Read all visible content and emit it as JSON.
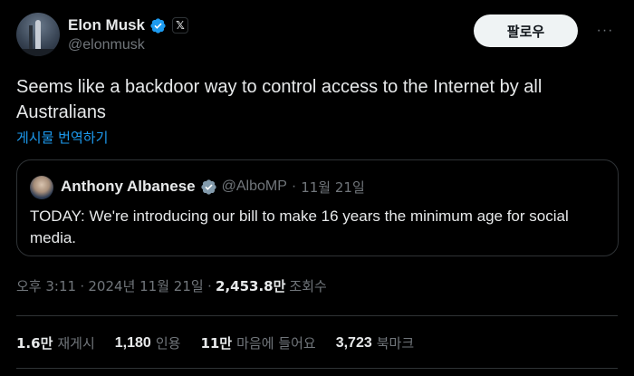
{
  "author": {
    "display_name": "Elon Musk",
    "handle": "@elonmusk",
    "x_badge": "𝕏",
    "verified_color": "#1d9bf0"
  },
  "actions": {
    "follow_label": "팔로우",
    "more_label": "···"
  },
  "tweet": {
    "text": "Seems like a backdoor way to control access to the Internet by all Australians",
    "translate_label": "게시물 번역하기"
  },
  "quote": {
    "display_name": "Anthony Albanese",
    "handle": "@AlboMP",
    "separator": "·",
    "date": "11월 21일",
    "text": "TODAY: We're introducing our bill to make 16 years the minimum age for social media."
  },
  "meta": {
    "time": "오후 3:11",
    "sep1": "·",
    "date": "2024년 11월 21일",
    "sep2": "·",
    "views_count": "2,453.8만",
    "views_label": "조회수"
  },
  "stats": [
    {
      "count": "1.6만",
      "label": "재게시"
    },
    {
      "count": "1,180",
      "label": "인용"
    },
    {
      "count": "11만",
      "label": "마음에 들어요"
    },
    {
      "count": "3,723",
      "label": "북마크"
    }
  ],
  "colors": {
    "background": "#000000",
    "text_primary": "#e7e9ea",
    "text_secondary": "#71767b",
    "accent": "#1d9bf0",
    "border": "#2f3336",
    "button_bg": "#eff3f4"
  }
}
